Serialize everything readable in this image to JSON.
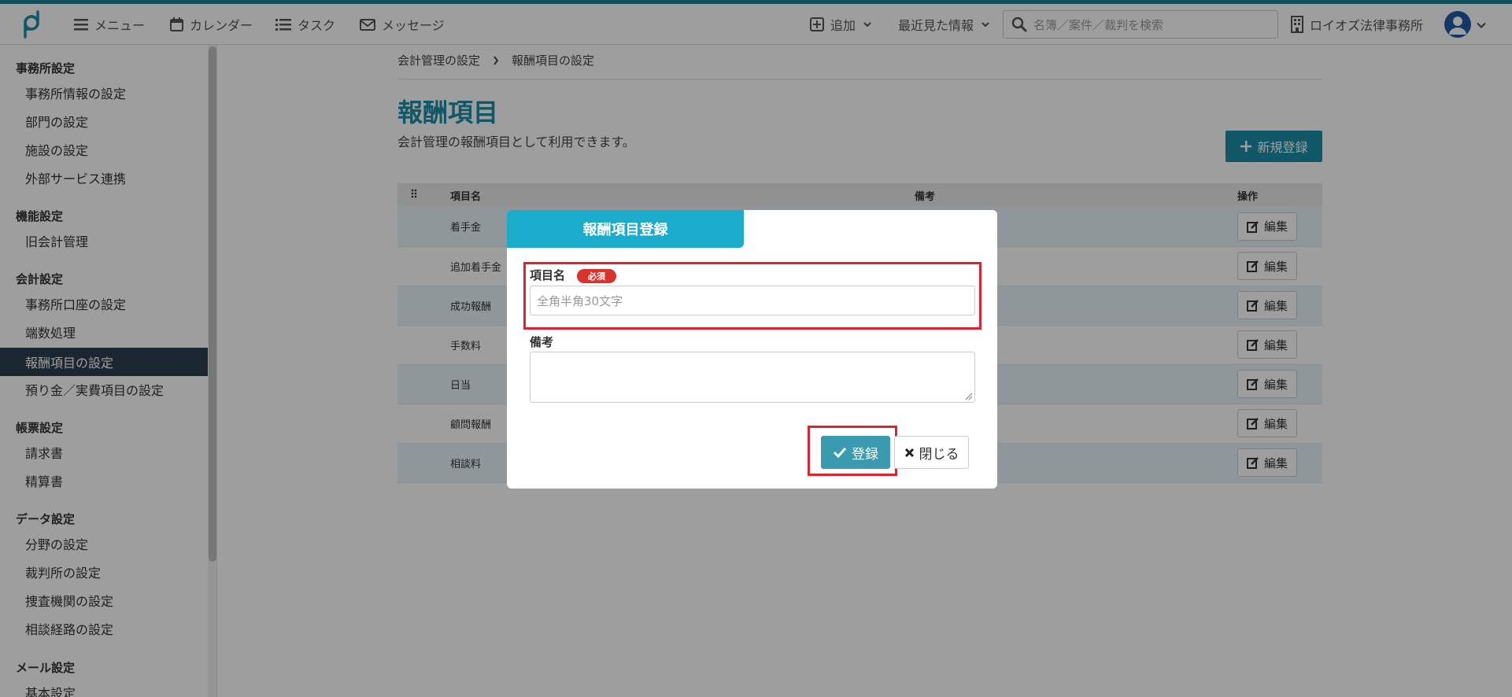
{
  "topbar": {
    "menu_label": "メニュー",
    "calendar_label": "カレンダー",
    "task_label": "タスク",
    "message_label": "メッセージ",
    "add_label": "追加",
    "recent_label": "最近見た情報",
    "search_placeholder": "名簿／案件／裁判を検索",
    "office_name": "ロイオズ法律事務所"
  },
  "sidebar": {
    "sections": [
      {
        "title": "事務所設定",
        "items": [
          "事務所情報の設定",
          "部門の設定",
          "施設の設定",
          "外部サービス連携"
        ]
      },
      {
        "title": "機能設定",
        "items": [
          "旧会計管理"
        ]
      },
      {
        "title": "会計設定",
        "items": [
          "事務所口座の設定",
          "端数処理",
          "報酬項目の設定",
          "預り金／実費項目の設定"
        ]
      },
      {
        "title": "帳票設定",
        "items": [
          "請求書",
          "精算書"
        ]
      },
      {
        "title": "データ設定",
        "items": [
          "分野の設定",
          "裁判所の設定",
          "捜査機関の設定",
          "相談経路の設定"
        ]
      },
      {
        "title": "メール設定",
        "items": [
          "基本設定"
        ]
      }
    ],
    "active_item": "報酬項目の設定"
  },
  "main": {
    "breadcrumb": [
      "会計管理の設定",
      "報酬項目の設定"
    ],
    "title": "報酬項目",
    "description": "会計管理の報酬項目として利用できます。",
    "new_button": "新規登録",
    "table": {
      "headers": [
        "項目名",
        "備考",
        "操作"
      ],
      "rows": [
        "着手金",
        "追加着手金",
        "成功報酬",
        "手数料",
        "日当",
        "顧問報酬",
        "相談料"
      ],
      "edit_label": "編集"
    }
  },
  "modal": {
    "title": "報酬項目登録",
    "field1_label": "項目名",
    "required_badge": "必須",
    "field1_placeholder": "全角半角30文字",
    "field2_label": "備考",
    "submit_label": "登録",
    "close_label": "閉じる"
  },
  "colors": {
    "accent": "#1a8fa8",
    "modal_header": "#1baccc",
    "highlight": "#e0212e",
    "sidebar_active": "#2d3e50"
  }
}
